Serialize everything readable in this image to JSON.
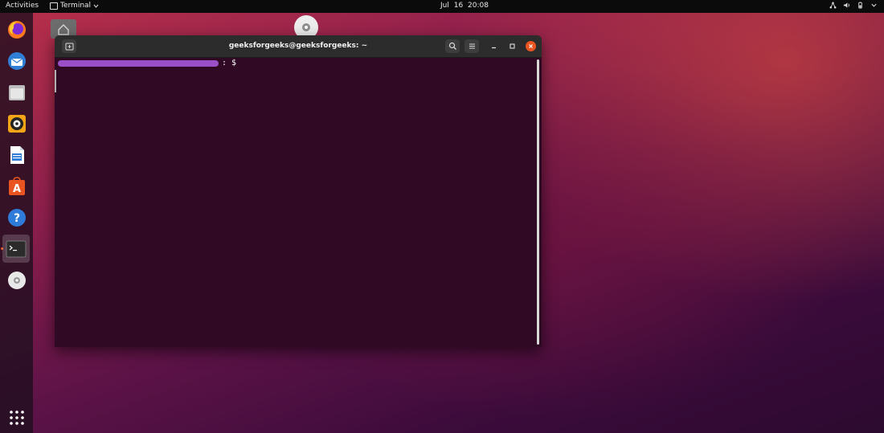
{
  "topbar": {
    "activities": "Activities",
    "app_menu": "Terminal",
    "clock_date": "Jul 16",
    "clock_time": "20:08"
  },
  "dock": {
    "items": [
      {
        "name": "firefox",
        "icon": "firefox-icon"
      },
      {
        "name": "thunderbird",
        "icon": "mail-icon"
      },
      {
        "name": "files",
        "icon": "folder-icon"
      },
      {
        "name": "rhythmbox",
        "icon": "speaker-icon"
      },
      {
        "name": "libreoffice-writer",
        "icon": "document-icon"
      },
      {
        "name": "software",
        "icon": "app-store-icon"
      },
      {
        "name": "help",
        "icon": "help-icon"
      },
      {
        "name": "terminal",
        "icon": "terminal-icon",
        "active": true
      },
      {
        "name": "dvd",
        "icon": "disc-icon"
      }
    ],
    "show_apps_icon": "grid-icon"
  },
  "terminal": {
    "title": "geeksforgeeks@geeksforgeeks: ~",
    "prompt_suffix": ": $"
  },
  "colors": {
    "terminal_bg": "#300a24",
    "header_bg": "#2c2c2c",
    "close_button": "#e95420",
    "redaction": "#9b4fc8"
  }
}
